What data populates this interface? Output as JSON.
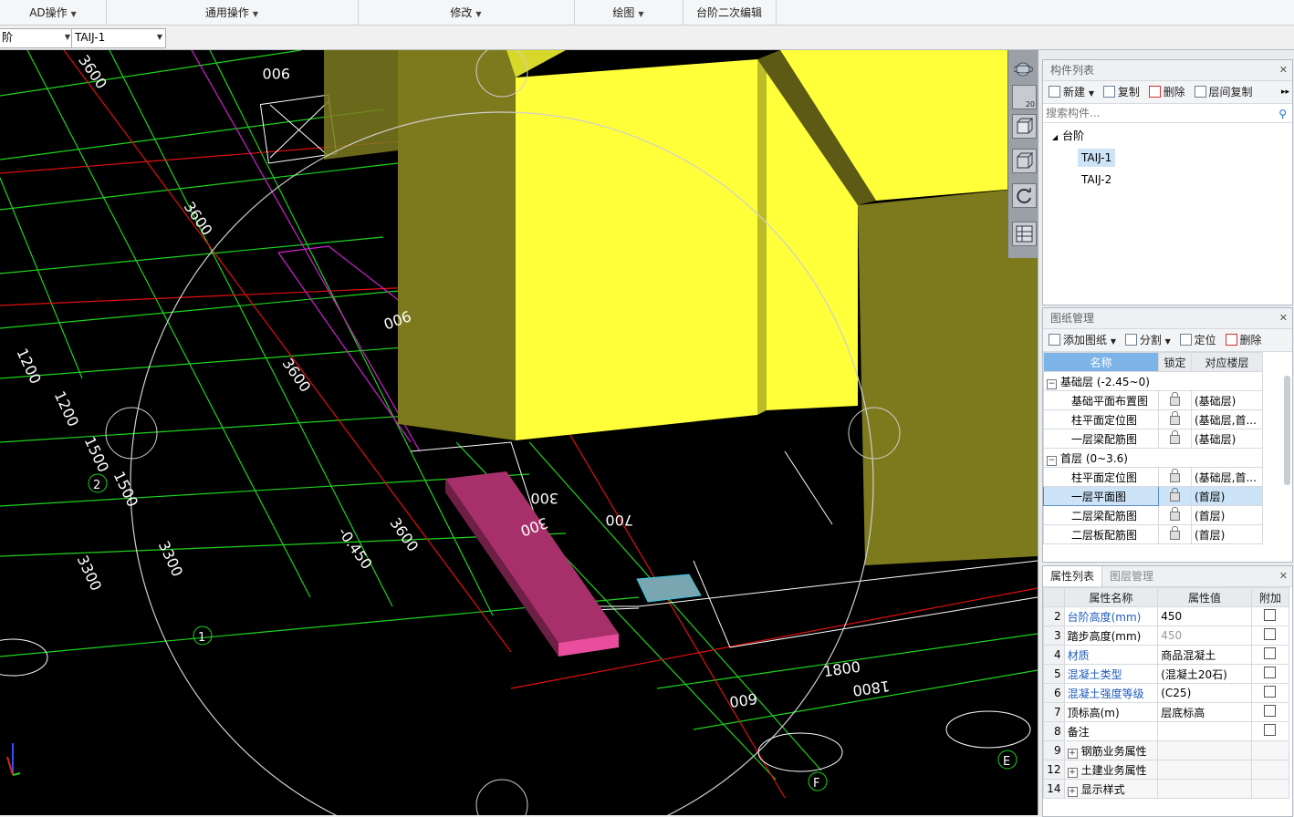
{
  "ribbon": {
    "groups": [
      "AD操作",
      "通用操作",
      "修改",
      "绘图",
      "台阶二次编辑"
    ]
  },
  "selectors": {
    "left_value": "阶",
    "right_value": "TAIJ-1"
  },
  "viewport": {
    "labels": {
      "dim_3600_a": "3600",
      "dim_3600_b": "3600",
      "dim_3600_c": "3600",
      "dim_3600_d": "3600",
      "dim_900_a": "900",
      "dim_900_b": "900",
      "dim_300_a": "300",
      "dim_300_b": "300",
      "dim_700": "700",
      "dim_1800_a": "1800",
      "dim_1800_b": "1800",
      "dim_600": "600",
      "dim_1200_a": "1200",
      "dim_1200_b": "1200",
      "dim_1500": "1500",
      "dim_3300_a": "3300",
      "dim_3300_b": "3300",
      "dim_0450": "-0.450",
      "dim_1500_b": "1500",
      "axis_2": "2",
      "axis_1": "1",
      "axis_E": "E",
      "axis_F": "F",
      "zoom": "20"
    },
    "colors": {
      "yellow_face": "#ffff3a",
      "yellow_side": "#7d7a1e",
      "step_slab": "#a8306a",
      "grid_green": "#1dd31d"
    }
  },
  "components": {
    "title": "构件列表",
    "toolbar": {
      "new": "新建",
      "copy": "复制",
      "delete": "删除",
      "floor_copy": "层间复制"
    },
    "search_placeholder": "搜索构件...",
    "tree": {
      "root": "台阶",
      "items": [
        "TAIJ-1",
        "TAIJ-2"
      ]
    }
  },
  "drawings": {
    "title": "图纸管理",
    "toolbar": {
      "add": "添加图纸",
      "split": "分割",
      "locate": "定位",
      "delete": "删除"
    },
    "headers": {
      "name": "名称",
      "lock": "锁定",
      "floor": "对应楼层"
    },
    "groups": [
      {
        "label": "基础层 (-2.45~0)",
        "rows": [
          {
            "name": "基础平面布置图",
            "floor": "(基础层)"
          },
          {
            "name": "柱平面定位图",
            "floor": "(基础层,首..."
          },
          {
            "name": "一层梁配筋图",
            "floor": "(基础层)"
          }
        ]
      },
      {
        "label": "首层 (0~3.6)",
        "rows": [
          {
            "name": "柱平面定位图",
            "floor": "(基础层,首..."
          },
          {
            "name": "一层平面图",
            "floor": "(首层)"
          },
          {
            "name": "二层梁配筋图",
            "floor": "(首层)"
          },
          {
            "name": "二层板配筋图",
            "floor": "(首层)"
          }
        ]
      }
    ]
  },
  "properties": {
    "tabs": [
      "属性列表",
      "图层管理"
    ],
    "headers": {
      "name": "属性名称",
      "value": "属性值",
      "extra": "附加"
    },
    "rows": [
      {
        "no": "2",
        "name": "台阶高度(mm)",
        "value": "450",
        "blue": true
      },
      {
        "no": "3",
        "name": "踏步高度(mm)",
        "value": "450",
        "blue": false,
        "grey": true
      },
      {
        "no": "4",
        "name": "材质",
        "value": "商品混凝土",
        "blue": true
      },
      {
        "no": "5",
        "name": "混凝土类型",
        "value": "(混凝土20石)",
        "blue": true
      },
      {
        "no": "6",
        "name": "混凝土强度等级",
        "value": "(C25)",
        "blue": true
      },
      {
        "no": "7",
        "name": "顶标高(m)",
        "value": "层底标高",
        "blue": false
      },
      {
        "no": "8",
        "name": "备注",
        "value": "",
        "blue": false
      },
      {
        "no": "9",
        "name": "钢筋业务属性",
        "value": "",
        "group": true
      },
      {
        "no": "12",
        "name": "土建业务属性",
        "value": "",
        "group": true
      },
      {
        "no": "14",
        "name": "显示样式",
        "value": "",
        "group": true
      }
    ]
  }
}
